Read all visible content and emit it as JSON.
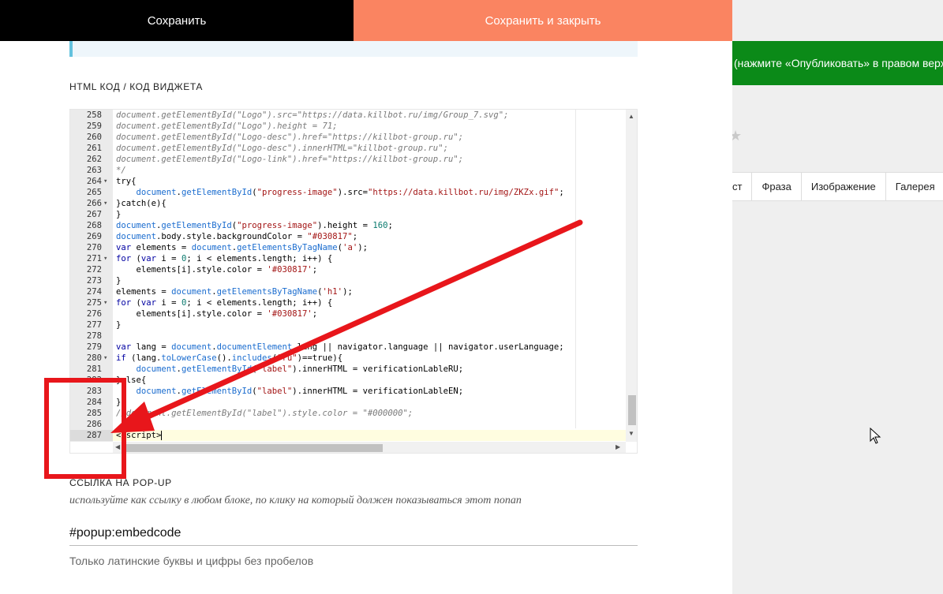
{
  "toolbar": {
    "save_label": "Сохранить",
    "save_close_label": "Сохранить и закрыть"
  },
  "section": {
    "html_code_title": "HTML КОД / КОД ВИДЖЕТА"
  },
  "background_page": {
    "banner_text": "(нажмите «Опубликовать» в правом верх",
    "tabs": [
      "ст",
      "Фраза",
      "Изображение",
      "Галерея"
    ]
  },
  "editor": {
    "lines": [
      {
        "n": "258",
        "fold": false,
        "html": "<span class=\"c-comment\">document.getElementById(\"Logo\").src=\"https://data.killbot.ru/img/Group_7.svg\";</span>"
      },
      {
        "n": "259",
        "fold": false,
        "html": "<span class=\"c-comment\">document.getElementById(\"Logo\").height = 71;</span>"
      },
      {
        "n": "260",
        "fold": false,
        "html": "<span class=\"c-comment\">document.getElementById(\"Logo-desc\").href=\"https://killbot-group.ru\";</span>"
      },
      {
        "n": "261",
        "fold": false,
        "html": "<span class=\"c-comment\">document.getElementById(\"Logo-desc\").innerHTML=\"killbot-group.ru\";</span>"
      },
      {
        "n": "262",
        "fold": false,
        "html": "<span class=\"c-comment\">document.getElementById(\"Logo-link\").href=\"https://killbot-group.ru\";</span>"
      },
      {
        "n": "263",
        "fold": false,
        "html": "<span class=\"c-comment\">*/</span>"
      },
      {
        "n": "264",
        "fold": true,
        "html": "try{"
      },
      {
        "n": "265",
        "fold": false,
        "html": "    <span class=\"c-fn\">document</span>.<span class=\"c-fn\">getElementById</span>(<span class=\"c-str\">\"progress-image\"</span>).src=<span class=\"c-str\">\"https://data.killbot.ru/img/ZKZx.gif\"</span>;"
      },
      {
        "n": "266",
        "fold": true,
        "html": "}catch(e){"
      },
      {
        "n": "267",
        "fold": false,
        "html": "}"
      },
      {
        "n": "268",
        "fold": false,
        "html": "<span class=\"c-fn\">document</span>.<span class=\"c-fn\">getElementById</span>(<span class=\"c-str\">\"progress-image\"</span>).height = <span class=\"c-num\">160</span>;"
      },
      {
        "n": "269",
        "fold": false,
        "html": "<span class=\"c-fn\">document</span>.body.style.backgroundColor = <span class=\"c-str\">\"#030817\"</span>;"
      },
      {
        "n": "270",
        "fold": false,
        "html": "<span class=\"c-kw\">var</span> elements = <span class=\"c-fn\">document</span>.<span class=\"c-fn\">getElementsByTagName</span>(<span class=\"c-str\">'a'</span>);"
      },
      {
        "n": "271",
        "fold": true,
        "html": "<span class=\"c-kw\">for</span> (<span class=\"c-kw\">var</span> i = <span class=\"c-num\">0</span>; i &lt; elements.length; i++) {"
      },
      {
        "n": "272",
        "fold": false,
        "html": "    elements[i].style.color = <span class=\"c-str\">'#030817'</span>;"
      },
      {
        "n": "273",
        "fold": false,
        "html": "}"
      },
      {
        "n": "274",
        "fold": false,
        "html": "elements = <span class=\"c-fn\">document</span>.<span class=\"c-fn\">getElementsByTagName</span>(<span class=\"c-str\">'h1'</span>);"
      },
      {
        "n": "275",
        "fold": true,
        "html": "<span class=\"c-kw\">for</span> (<span class=\"c-kw\">var</span> i = <span class=\"c-num\">0</span>; i &lt; elements.length; i++) {"
      },
      {
        "n": "276",
        "fold": false,
        "html": "    elements[i].style.color = <span class=\"c-str\">'#030817'</span>;"
      },
      {
        "n": "277",
        "fold": false,
        "html": "}"
      },
      {
        "n": "278",
        "fold": false,
        "html": ""
      },
      {
        "n": "279",
        "fold": false,
        "html": "<span class=\"c-kw\">var</span> lang = <span class=\"c-fn\">document</span>.<span class=\"c-fn\">documentElement</span>.lang || navigator.language || navigator.userLanguage;"
      },
      {
        "n": "280",
        "fold": true,
        "html": "<span class=\"c-kw\">if</span> (lang.<span class=\"c-fn\">toLowerCase</span>().<span class=\"c-fn\">includes</span>(<span class=\"c-str\">\"ru\"</span>)==true){"
      },
      {
        "n": "281",
        "fold": false,
        "html": "    <span class=\"c-fn\">document</span>.<span class=\"c-fn\">getElementById</span>(<span class=\"c-str\">\"label\"</span>).innerHTML = verificationLableRU;"
      },
      {
        "n": "282",
        "fold": false,
        "html": "}else{"
      },
      {
        "n": "283",
        "fold": false,
        "html": "    <span class=\"c-fn\">document</span>.<span class=\"c-fn\">getElementById</span>(<span class=\"c-str\">\"label\"</span>).innerHTML = verificationLableEN;"
      },
      {
        "n": "284",
        "fold": false,
        "html": "}"
      },
      {
        "n": "285",
        "fold": false,
        "html": "<span class=\"c-comment\">//document.getElementById(\"label\").style.color = \"#000000\";</span>"
      },
      {
        "n": "286",
        "fold": false,
        "html": ""
      },
      {
        "n": "287",
        "fold": false,
        "html": "&lt;/script&gt;"
      }
    ],
    "active_line": "287"
  },
  "popup": {
    "title": "ССЫЛКА НА POP-UP",
    "description": "используйте как ссылку в любом блоке, по клику на который должен показываться этот попап",
    "value": "#popup:embedcode",
    "hint": "Только латинские буквы и цифры без пробелов"
  },
  "colors": {
    "save_bg": "#000000",
    "save_close_bg": "#fa8461",
    "banner_bg": "#0b8a18",
    "annotation": "#e8161b"
  }
}
